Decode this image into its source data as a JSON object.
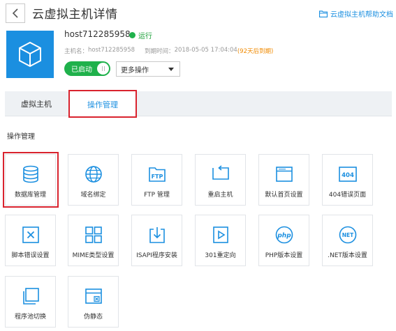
{
  "header": {
    "back_icon": "chevron-left-icon",
    "title": "云虚拟主机详情",
    "help_icon": "folder-icon",
    "help_label": "云虚拟主机帮助文档"
  },
  "host": {
    "icon": "cube-icon",
    "name": "host712285958",
    "status": "运行",
    "status_color": "#1fb14b",
    "meta_host_label": "主机名：",
    "meta_host_value": "host712285958",
    "meta_expire_label": "到期时间：",
    "meta_expire_value": "2018-05-05 17:04:04",
    "meta_warning": "(92天后到期)",
    "toggle_label": "已启动",
    "more_ops": "更多操作"
  },
  "tabs": [
    {
      "label": "虚拟主机"
    },
    {
      "label": "操作管理"
    }
  ],
  "section_title": "操作管理",
  "accent_color": "#1b8fe0",
  "highlight_color": "#d9232e",
  "tiles": [
    {
      "label": "数据库管理",
      "icon": "database-icon"
    },
    {
      "label": "域名绑定",
      "icon": "globe-icon"
    },
    {
      "label": "FTP 管理",
      "icon": "ftp-folder-icon",
      "icon_text": "FTP"
    },
    {
      "label": "重启主机",
      "icon": "restart-icon"
    },
    {
      "label": "默认首页设置",
      "icon": "browser-window-icon"
    },
    {
      "label": "404错误页面",
      "icon": "404-icon",
      "icon_text": "404"
    },
    {
      "label": "脚本错误设置",
      "icon": "close-box-icon"
    },
    {
      "label": "MIME类型设置",
      "icon": "grid-icon"
    },
    {
      "label": "ISAPI程序安装",
      "icon": "install-icon"
    },
    {
      "label": "301重定向",
      "icon": "play-box-icon"
    },
    {
      "label": "PHP版本设置",
      "icon": "php-icon",
      "icon_text": "php"
    },
    {
      "label": ".NET版本设置",
      "icon": "net-icon",
      "icon_text": "NET"
    },
    {
      "label": "程序池切换",
      "icon": "stacked-windows-icon"
    },
    {
      "label": "伪静态",
      "icon": "window-close-icon"
    }
  ]
}
